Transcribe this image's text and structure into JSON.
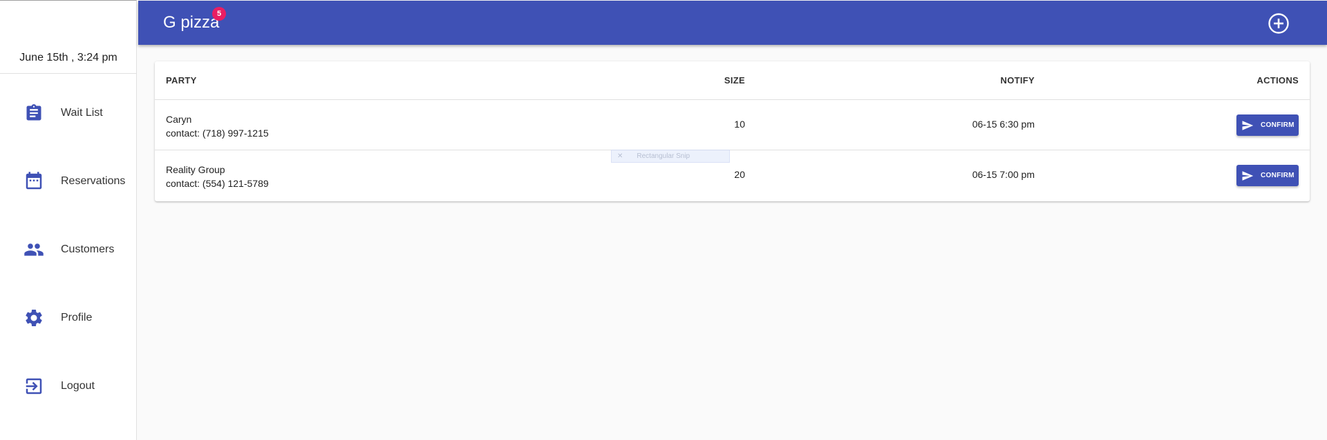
{
  "sidebar": {
    "datetime": "June 15th , 3:24 pm",
    "items": [
      {
        "label": "Wait List",
        "icon": "clipboard-icon"
      },
      {
        "label": "Reservations",
        "icon": "calendar-icon"
      },
      {
        "label": "Customers",
        "icon": "people-icon"
      },
      {
        "label": "Profile",
        "icon": "gear-icon"
      },
      {
        "label": "Logout",
        "icon": "logout-icon"
      }
    ]
  },
  "header": {
    "title": "G pizza",
    "badge_count": "5",
    "add_icon": "add-circle-icon"
  },
  "table": {
    "columns": [
      "PARTY",
      "SIZE",
      "NOTIFY",
      "ACTIONS"
    ],
    "rows": [
      {
        "name": "Caryn",
        "contact": "contact: (718) 997-1215",
        "size": "10",
        "notify": "06-15 6:30 pm",
        "action": "CONFIRM"
      },
      {
        "name": "Reality Group",
        "contact": "contact: (554) 121-5789",
        "size": "20",
        "notify": "06-15 7:00 pm",
        "action": "CONFIRM"
      }
    ]
  },
  "overlay": {
    "snip_label": "Rectangular Snip"
  },
  "colors": {
    "primary": "#3f51b5",
    "badge": "#e91e63",
    "background": "#fafafa"
  }
}
